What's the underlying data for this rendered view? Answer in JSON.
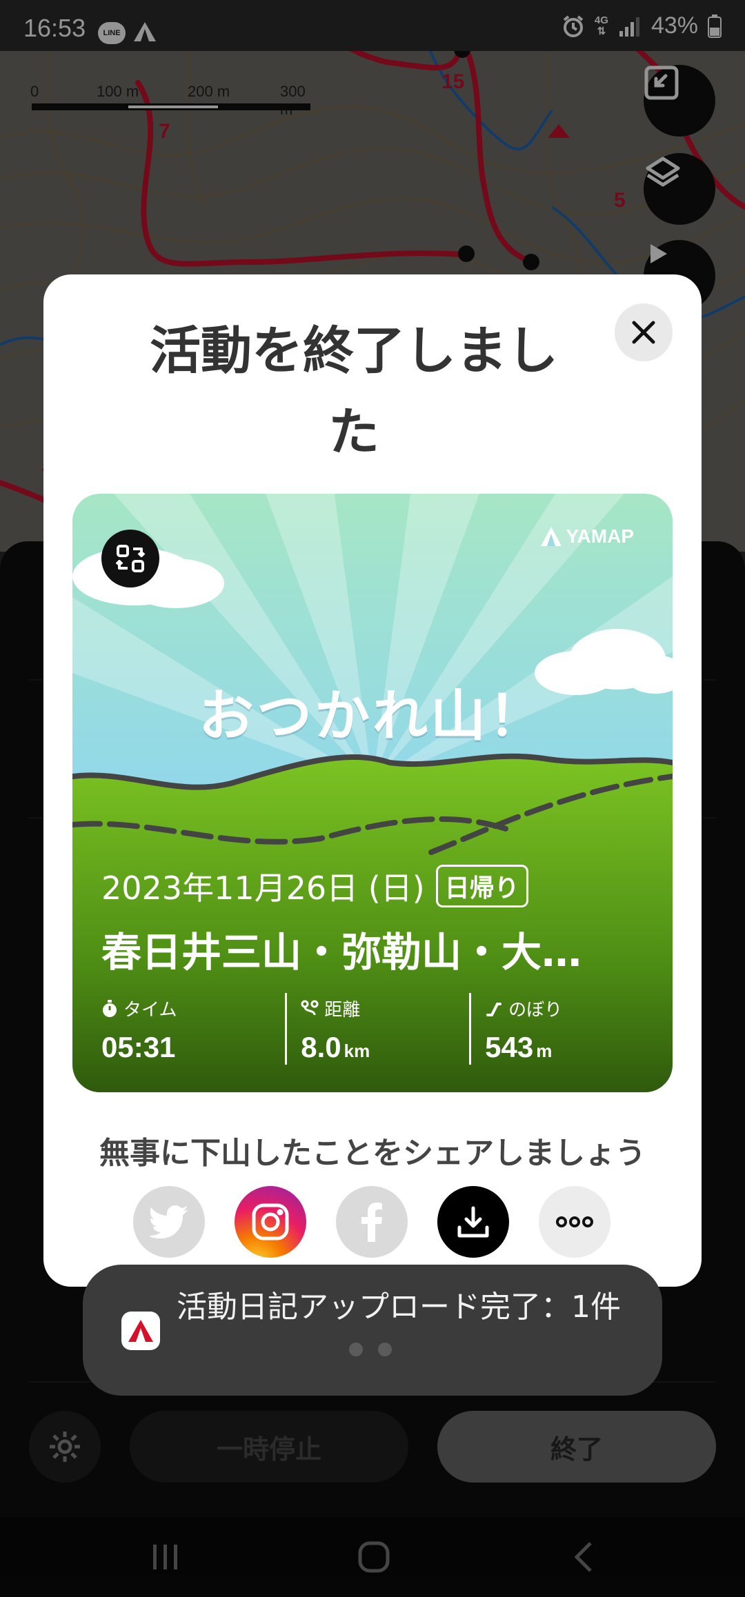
{
  "status_bar": {
    "time": "16:53",
    "line_badge": "LINE",
    "network": "4G",
    "battery": "43%"
  },
  "map": {
    "scale_labels": [
      "0",
      "100 m",
      "200 m",
      "300 m"
    ]
  },
  "modal": {
    "title": "活動を終了しました",
    "card": {
      "brand": "YAMAP",
      "cheer": "おつかれ山！",
      "date": "2023年11月26日 (日)",
      "trip_tag": "日帰り",
      "place": "春日井三山・弥勒山・大…",
      "stats": [
        {
          "label": "タイム",
          "value": "05:31",
          "unit": "",
          "icon": "stopwatch-icon"
        },
        {
          "label": "距離",
          "value": "8.0",
          "unit": "km",
          "icon": "route-icon"
        },
        {
          "label": "のぼり",
          "value": "543",
          "unit": "m",
          "icon": "ascent-icon"
        }
      ]
    },
    "share_prompt": "無事に下山したことをシェアしましょう",
    "share_buttons": [
      "twitter-icon",
      "instagram-icon",
      "facebook-icon",
      "download-icon",
      "more-icon"
    ]
  },
  "toast": {
    "message": "活動日記アップロード完了：1件"
  },
  "bottom_controls": {
    "pause_label": "一時停止",
    "end_label": "終了"
  },
  "colors": {
    "route_red": "#c8102e",
    "route_blue": "#1565c0",
    "instagram_gradient": [
      "#f9a825",
      "#e91e63",
      "#8e24aa"
    ],
    "card_sky": "#7fd3ea",
    "card_green": "#5aa219"
  }
}
